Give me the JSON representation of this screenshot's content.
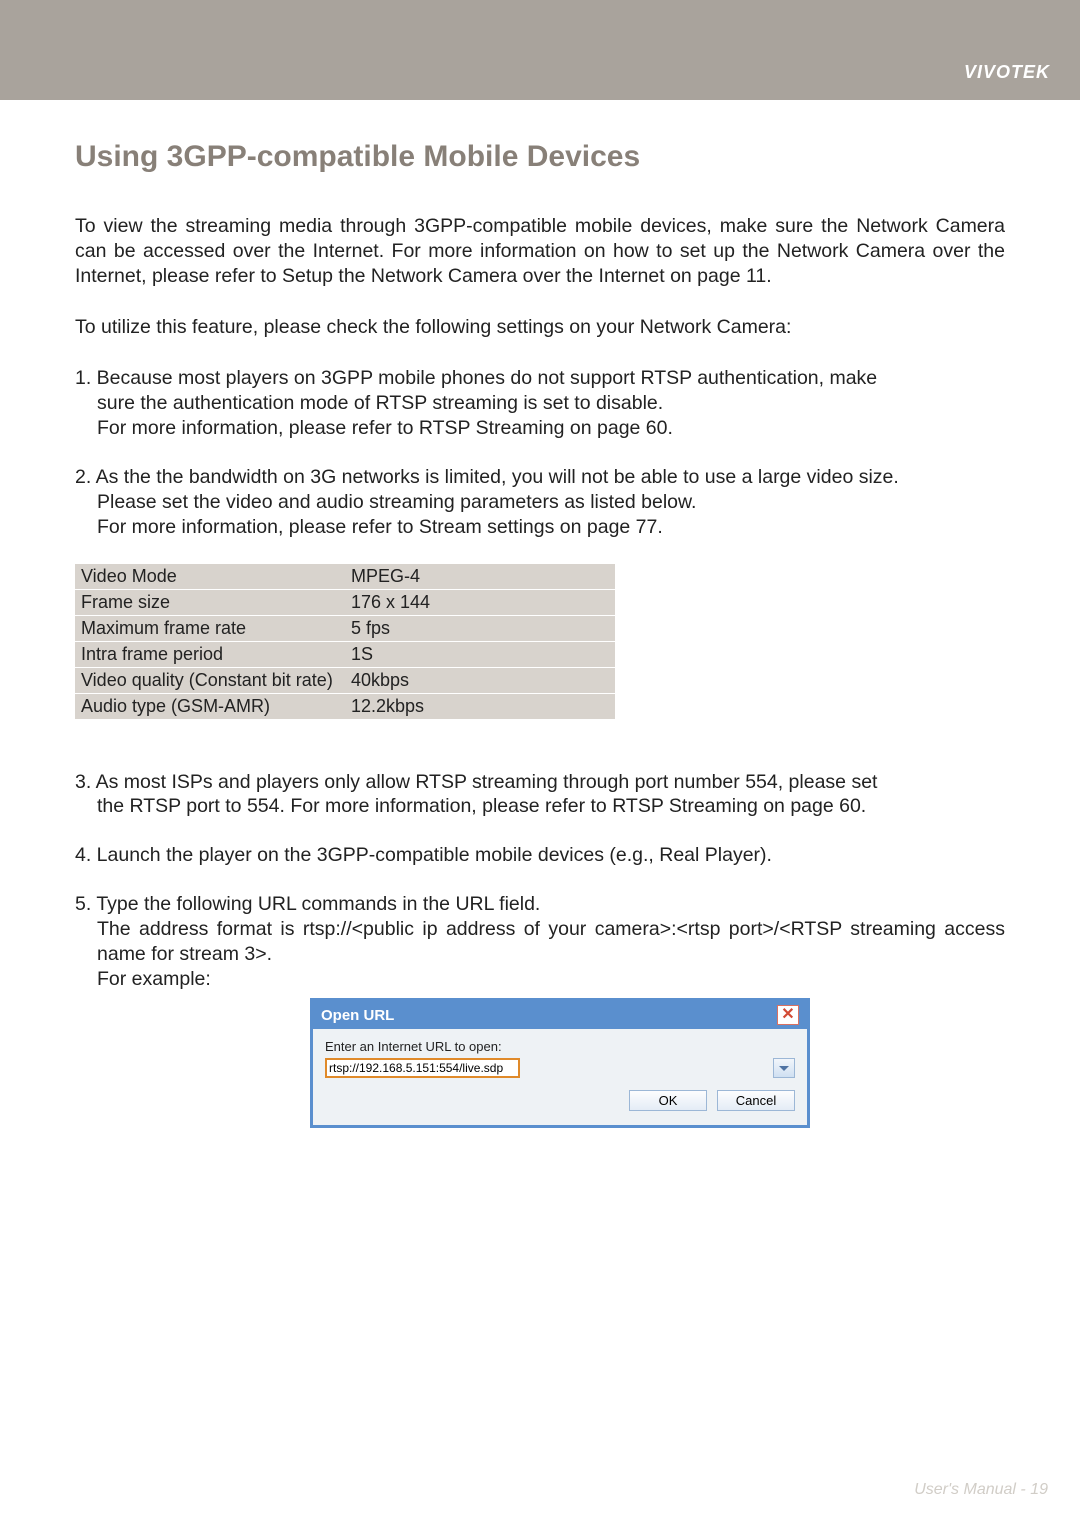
{
  "brand": "VIVOTEK",
  "title": "Using 3GPP-compatible Mobile Devices",
  "para_intro": "To view the streaming media through 3GPP-compatible mobile devices, make sure the Network Camera can be accessed over the Internet. For more information on how to set up the Network Camera over the Internet, please refer to Setup the Network Camera over the Internet on page 11.",
  "para_utilize": "To utilize this feature, please check the following settings on your Network Camera:",
  "item1_a": "1. Because most players on 3GPP mobile phones do not support RTSP authentication, make",
  "item1_b": "sure the authentication mode of RTSP streaming is set to disable.",
  "item1_c": "For more information, please refer to RTSP Streaming on page 60.",
  "item2_a": "2. As the the bandwidth on 3G networks is limited, you will not be able to use a large video size.",
  "item2_b": "Please set the video and audio streaming parameters as listed below.",
  "item2_c": "For more information, please refer to Stream settings on page 77.",
  "settings": [
    {
      "k": "Video Mode",
      "v": "MPEG-4"
    },
    {
      "k": "Frame size",
      "v": "176 x 144"
    },
    {
      "k": "Maximum frame rate",
      "v": "5 fps"
    },
    {
      "k": "Intra frame period",
      "v": "1S"
    },
    {
      "k": "Video quality (Constant bit rate)",
      "v": "40kbps"
    },
    {
      "k": "Audio type (GSM-AMR)",
      "v": "12.2kbps"
    }
  ],
  "item3_a": "3. As most ISPs and players only allow RTSP streaming through port number 554, please set",
  "item3_b": "the RTSP port to 554. For more information, please refer to RTSP Streaming on page 60.",
  "item4": "4. Launch the player on the 3GPP-compatible mobile devices (e.g., Real Player).",
  "item5_a": "5. Type the following URL commands in the URL field.",
  "item5_b": "The address format is rtsp://<public ip address of your camera>:<rtsp port>/<RTSP streaming access name for stream 3>.",
  "item5_c": "For example:",
  "dialog": {
    "title": "Open URL",
    "close": "✕",
    "label": "Enter an Internet URL to open:",
    "value": "rtsp://192.168.5.151:554/live.sdp",
    "ok": "OK",
    "cancel": "Cancel"
  },
  "footer_label": "User's Manual - ",
  "page_number": "19"
}
